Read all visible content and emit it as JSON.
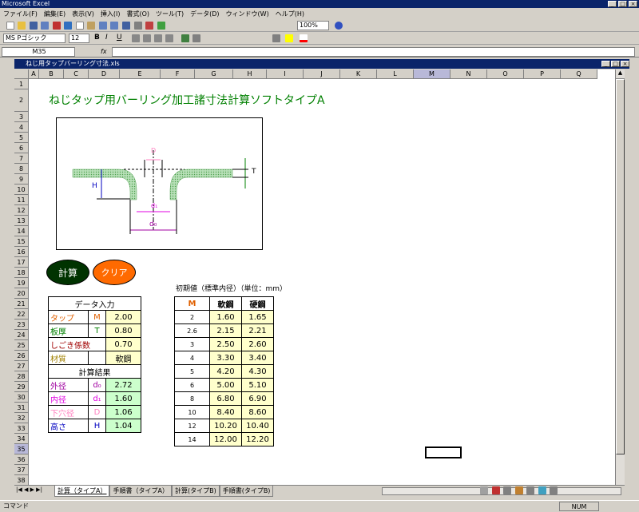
{
  "app": {
    "title": "Microsoft Excel"
  },
  "menu": [
    "ファイル(F)",
    "編集(E)",
    "表示(V)",
    "挿入(I)",
    "書式(O)",
    "ツール(T)",
    "データ(D)",
    "ウィンドウ(W)",
    "ヘルプ(H)"
  ],
  "toolbar": {
    "zoom": "100%",
    "font": "MS Pゴシック",
    "size": "12"
  },
  "formula": {
    "cell_ref": "M35",
    "fx": "fx"
  },
  "workbook": {
    "title": "ねじ用タップバーリング寸法.xls"
  },
  "columns": [
    "A",
    "B",
    "C",
    "D",
    "E",
    "F",
    "G",
    "H",
    "I",
    "J",
    "K",
    "L",
    "M",
    "N",
    "O",
    "P",
    "Q"
  ],
  "rows": [
    "1",
    "2",
    "3",
    "4",
    "5",
    "6",
    "7",
    "8",
    "9",
    "10",
    "11",
    "12",
    "13",
    "14",
    "15",
    "16",
    "17",
    "18",
    "19",
    "20",
    "21",
    "22",
    "23",
    "24",
    "25",
    "26",
    "27",
    "28",
    "29",
    "30",
    "31",
    "32",
    "33",
    "34",
    "35",
    "36",
    "37",
    "38"
  ],
  "sheet": {
    "heading": "ねじタップ用バーリング加工諸寸法計算ソフトタイプA",
    "diagram": {
      "label_t": "T",
      "label_h": "H",
      "label_d": "D",
      "label_d1": "d₁",
      "label_d0": "d₀"
    },
    "calc_button": "計算",
    "clear_button": "クリア",
    "input_title": "データ入力",
    "inputs": [
      {
        "label": "タップ",
        "sym": "M",
        "value": "2.00",
        "color": "#e06000"
      },
      {
        "label": "板厚",
        "sym": "T",
        "value": "0.80",
        "color": "#008000"
      },
      {
        "label": "しごき係数",
        "sym": "",
        "value": "0.70",
        "color": "#a00000"
      },
      {
        "label": "材質",
        "sym": "",
        "value": "軟鋼",
        "color": "#a08000"
      }
    ],
    "result_title": "計算結果",
    "results": [
      {
        "label": "外径",
        "sym": "d₀",
        "value": "2.72",
        "color": "#a000a0"
      },
      {
        "label": "内径",
        "sym": "d₁",
        "value": "1.60",
        "color": "#e000e0"
      },
      {
        "label": "下穴径",
        "sym": "D",
        "value": "1.06",
        "color": "#ff80c0"
      },
      {
        "label": "高さ",
        "sym": "H",
        "value": "1.04",
        "color": "#0000c0"
      }
    ],
    "initial_title": "初期値（標準内径）（単位：mm）",
    "initial_headers": [
      "M",
      "軟鋼",
      "硬鋼"
    ],
    "initial_rows": [
      [
        "2",
        "1.60",
        "1.65"
      ],
      [
        "2.6",
        "2.15",
        "2.21"
      ],
      [
        "3",
        "2.50",
        "2.60"
      ],
      [
        "4",
        "3.30",
        "3.40"
      ],
      [
        "5",
        "4.20",
        "4.30"
      ],
      [
        "6",
        "5.00",
        "5.10"
      ],
      [
        "8",
        "6.80",
        "6.90"
      ],
      [
        "10",
        "8.40",
        "8.60"
      ],
      [
        "12",
        "10.20",
        "10.40"
      ],
      [
        "14",
        "12.00",
        "12.20"
      ]
    ]
  },
  "tabs": [
    "計算（タイプA）",
    "手順書（タイプA）",
    "計算(タイプB)",
    "手順書(タイプB)"
  ],
  "status": {
    "left": "コマンド",
    "right": "NUM"
  }
}
